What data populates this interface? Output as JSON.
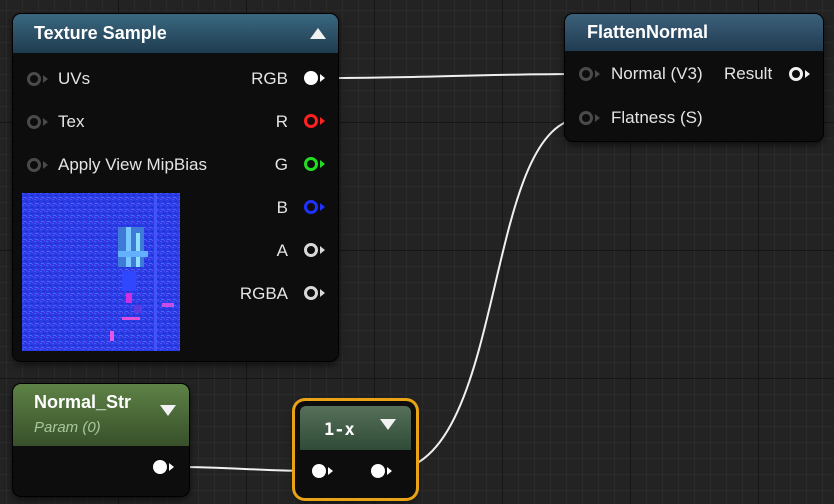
{
  "texture_sample": {
    "title": "Texture Sample",
    "inputs": [
      "UVs",
      "Tex",
      "Apply View MipBias"
    ],
    "outputs": [
      "RGB",
      "R",
      "G",
      "B",
      "A",
      "RGBA"
    ]
  },
  "flatten_normal": {
    "title": "FlattenNormal",
    "input_normal": "Normal (V3)",
    "input_flatness": "Flatness (S)",
    "output_result": "Result"
  },
  "normal_str": {
    "title": "Normal_Str",
    "subtitle": "Param (0)"
  },
  "one_minus": {
    "title": "1-x"
  },
  "colors": {
    "texture_header": "#2a4f66",
    "flatten_header": "#2d4a60",
    "param_header": "#4c6e3a",
    "selection": "#e8a317"
  },
  "icons": [
    "collapse-up-icon",
    "dropdown-icon",
    "texture-preview"
  ]
}
